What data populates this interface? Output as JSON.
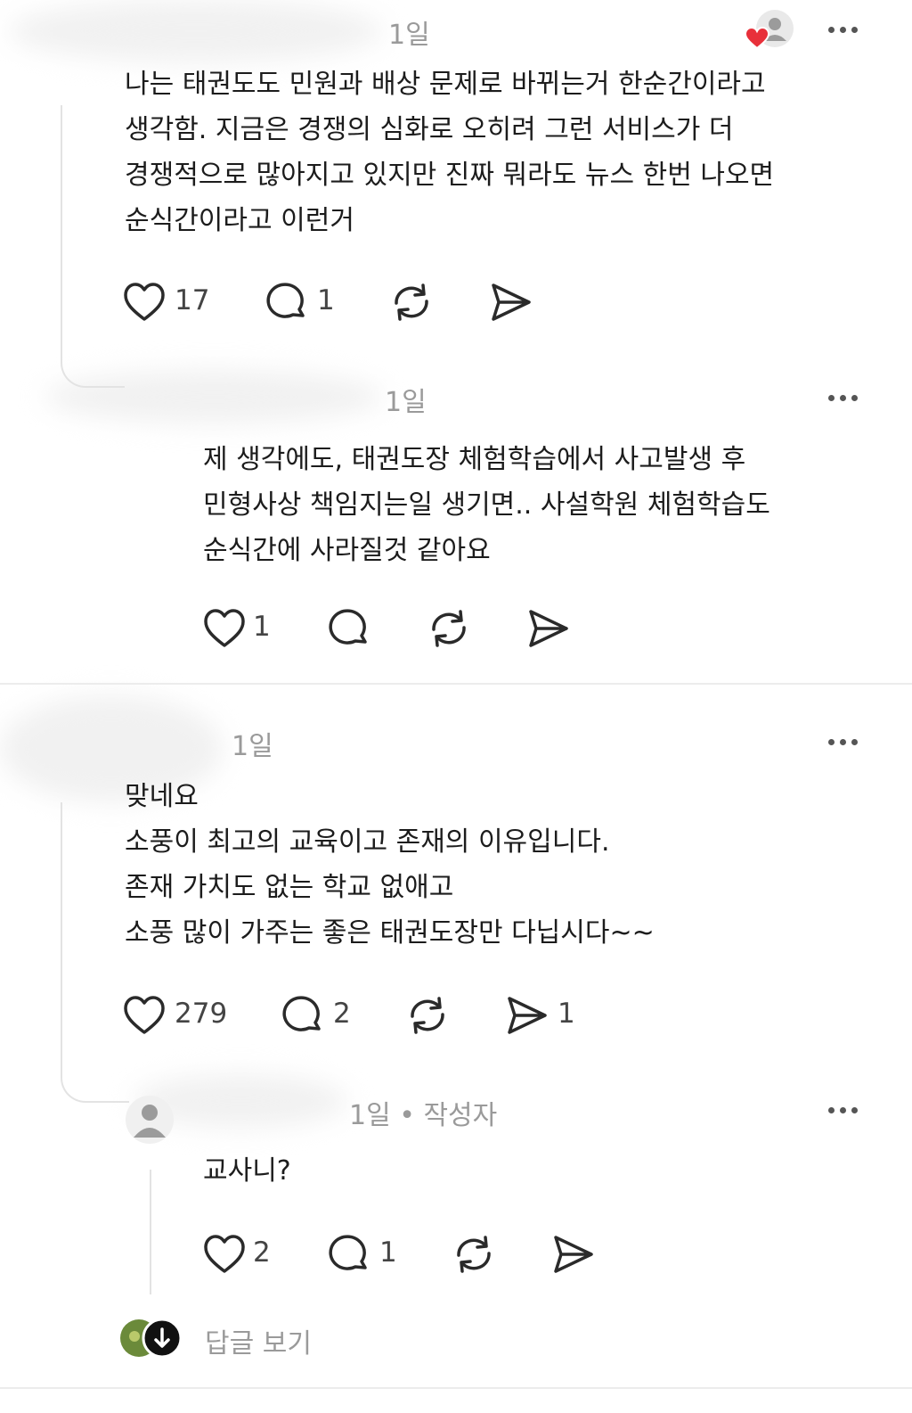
{
  "comments": [
    {
      "time": "1일",
      "lines": [
        "나는 태권도도 민원과 배상 문제로 바뀌는거 한순간이라고",
        "생각함. 지금은 경쟁의 심화로 오히려 그런 서비스가 더",
        "경쟁적으로 많아지고 있지만 진짜 뭐라도 뉴스 한번 나오면",
        "순식간이라고 이런거"
      ],
      "likes": "17",
      "replies": "1",
      "shares": ""
    },
    {
      "time": "1일",
      "lines": [
        "제 생각에도, 태권도장 체험학습에서 사고발생 후",
        "민형사상 책임지는일 생기면.. 사설학원 체험학습도",
        "순식간에 사라질것 같아요"
      ],
      "likes": "1",
      "replies": "",
      "shares": ""
    },
    {
      "time": "1일",
      "lines": [
        "맞네요",
        "소풍이 최고의 교육이고 존재의 이유입니다.",
        "존재 가치도 없는 학교 없애고",
        "소풍 많이 가주는 좋은 태권도장만 다닙시다~~"
      ],
      "likes": "279",
      "replies": "2",
      "shares": "1"
    },
    {
      "time": "1일 • 작성자",
      "lines": [
        "교사니?"
      ],
      "likes": "2",
      "replies": "1",
      "shares": ""
    }
  ],
  "view_replies_label": "답글 보기",
  "colors": {
    "heart_badge": "#e8303a",
    "muted_text": "#9a9a9a",
    "icon_stroke": "#2a2a2a"
  }
}
